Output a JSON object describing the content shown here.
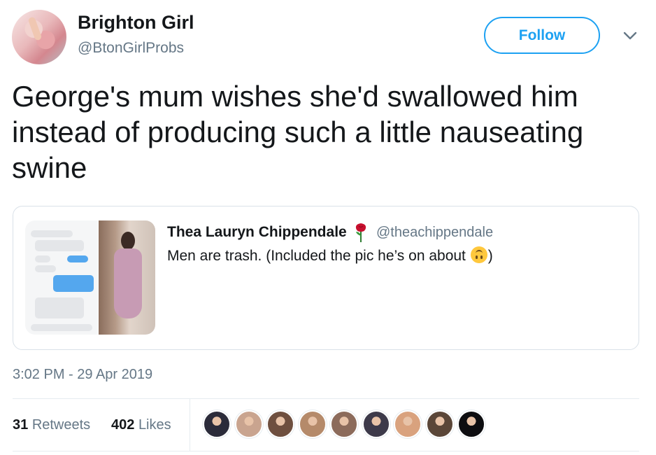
{
  "author": {
    "name": "Brighton Girl",
    "handle": "@BtonGirlProbs",
    "avatar_icon": "profile-photo"
  },
  "follow_button": {
    "label": "Follow"
  },
  "tweet": {
    "text": "George's mum wishes she'd swallowed him instead of producing such a little nauseating swine"
  },
  "quoted_tweet": {
    "name": "Thea Lauryn Chippendale",
    "name_emoji": "rose-icon",
    "handle": "@theachippendale",
    "text_before_emoji": "Men are trash. (Included the pic he’s on about ",
    "emoji": "upside-down-face-icon",
    "text_after_emoji": ")"
  },
  "timestamp": "3:02 PM - 29 Apr 2019",
  "stats": {
    "retweets_count": "31",
    "retweets_label": "Retweets",
    "likes_count": "402",
    "likes_label": "Likes"
  },
  "likers": [
    {
      "name": "liker-avatar-1",
      "color": "#2b2b3a"
    },
    {
      "name": "liker-avatar-2",
      "color": "#c9a48f"
    },
    {
      "name": "liker-avatar-3",
      "color": "#6e4f3f"
    },
    {
      "name": "liker-avatar-4",
      "color": "#b58a6a"
    },
    {
      "name": "liker-avatar-5",
      "color": "#8c6b5b"
    },
    {
      "name": "liker-avatar-6",
      "color": "#3d3a4a"
    },
    {
      "name": "liker-avatar-7",
      "color": "#d9a27e"
    },
    {
      "name": "liker-avatar-8",
      "color": "#5a4638"
    },
    {
      "name": "liker-avatar-9",
      "color": "#0d0d10"
    }
  ],
  "colors": {
    "accent": "#1da1f2",
    "text_primary": "#14171a",
    "text_secondary": "#657786",
    "border": "#e6ecf0"
  }
}
